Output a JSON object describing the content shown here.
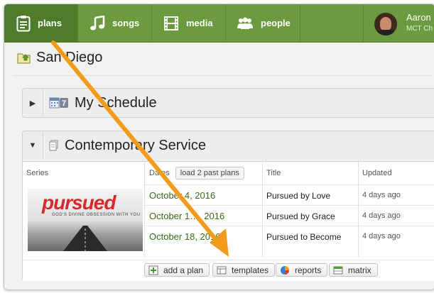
{
  "nav": {
    "tabs": [
      {
        "label": "plans",
        "icon": "clipboard-icon"
      },
      {
        "label": "songs",
        "icon": "music-note-icon"
      },
      {
        "label": "media",
        "icon": "film-icon"
      },
      {
        "label": "people",
        "icon": "people-icon"
      }
    ],
    "active_tab": "plans",
    "user": {
      "name": "Aaron",
      "org": "MCT Ch"
    }
  },
  "breadcrumb": {
    "title": "San Diego",
    "icon": "folder-icon"
  },
  "schedule": {
    "caret": "▶",
    "calendar_day": "7",
    "title": "My Schedule"
  },
  "service": {
    "caret": "▼",
    "title": "Contemporary Service",
    "columns": {
      "series": "Series",
      "dates": "Dates",
      "title": "Title",
      "updated": "Updated"
    },
    "load_past": "load 2 past plans",
    "series_art": {
      "word": "pursued",
      "tagline": "GOD'S DIVINE OBSESSION WITH YOU"
    },
    "plans": [
      {
        "date": "October 4, 2016",
        "title": "Pursued by Love",
        "updated": "4 days ago"
      },
      {
        "date": "October 1…, 2016",
        "title": "Pursued by Grace",
        "updated": "4 days ago"
      },
      {
        "date": "October 18, 2016",
        "title": "Pursued to Become",
        "updated": "4 days ago"
      }
    ],
    "actions": {
      "add_plan": "add a plan",
      "templates": "templates",
      "reports": "reports",
      "matrix": "matrix"
    }
  },
  "colors": {
    "nav_green": "#6b9a3f",
    "nav_active": "#4e7c2b",
    "date_green": "#3a6b16",
    "annotation_arrow": "#f59b1c",
    "brand_red": "#d82a2a"
  }
}
